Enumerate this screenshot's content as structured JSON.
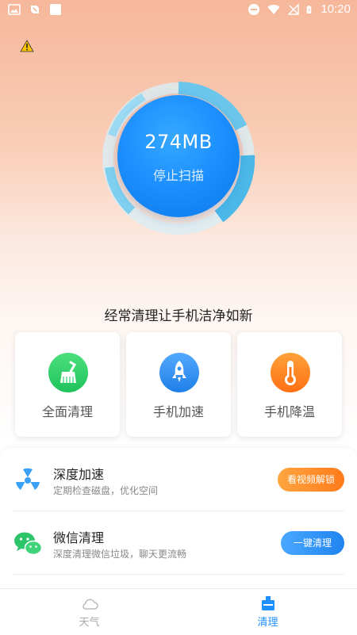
{
  "status_bar": {
    "time": "10:20"
  },
  "scan": {
    "size": "274MB",
    "action": "停止扫描"
  },
  "slogan": "经常清理让手机洁净如新",
  "features": [
    {
      "label": "全面清理",
      "icon": "broom-icon",
      "color": "#2fd36b"
    },
    {
      "label": "手机加速",
      "icon": "rocket-icon",
      "color": "#2f8ff5"
    },
    {
      "label": "手机降温",
      "icon": "thermometer-icon",
      "color": "#ff8a1f"
    }
  ],
  "list": [
    {
      "title": "深度加速",
      "subtitle": "定期检查磁盘，优化空间",
      "button": "看视频解锁",
      "icon": "radiation-fan-icon"
    },
    {
      "title": "微信清理",
      "subtitle": "深度清理微信垃圾，聊天更流畅",
      "button": "一键清理",
      "icon": "wechat-icon"
    }
  ],
  "nav": [
    {
      "label": "天气",
      "icon": "cloud-icon",
      "active": false
    },
    {
      "label": "清理",
      "icon": "clean-icon",
      "active": true
    }
  ],
  "colors": {
    "accent": "#1e90ff",
    "orange": "#ff8a1f",
    "inactive": "#aaaaaa"
  }
}
